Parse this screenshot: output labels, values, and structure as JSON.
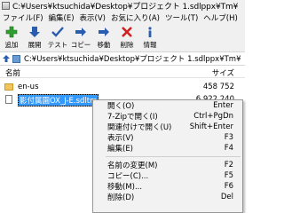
{
  "window": {
    "title": "C:¥Users¥ktsuchida¥Desktop¥プロジェクト 1.sdlppx¥Tm¥"
  },
  "menubar": [
    "ファイル(F)",
    "編集(E)",
    "表示(V)",
    "お気に入り(A)",
    "ツール(T)",
    "ヘルプ(H)"
  ],
  "toolbar": [
    {
      "label": "追加",
      "icon": "add-icon",
      "color": "#2e9e2e"
    },
    {
      "label": "展開",
      "icon": "extract-icon",
      "color": "#2a5db0"
    },
    {
      "label": "テスト",
      "icon": "test-icon",
      "color": "#2a5db0"
    },
    {
      "label": "コピー",
      "icon": "copy-icon",
      "color": "#2a5db0"
    },
    {
      "label": "移動",
      "icon": "move-icon",
      "color": "#2a5db0"
    },
    {
      "label": "削除",
      "icon": "delete-icon",
      "color": "#d02020"
    },
    {
      "label": "情報",
      "icon": "info-icon",
      "color": "#2a5db0"
    }
  ],
  "address": {
    "path": "C:¥Users¥ktsuchida¥Desktop¥プロジェクト 1.sdlppx¥Tm¥"
  },
  "list": {
    "col_name": "名前",
    "col_size": "サイズ",
    "rows": [
      {
        "name": "en-us",
        "size": "458 752",
        "kind": "folder"
      },
      {
        "name": "影付属園OX_J-E.sdltm",
        "size": "6 922 240",
        "kind": "file",
        "selected": true
      }
    ]
  },
  "context_menu": {
    "items": [
      {
        "label": "開く(O)",
        "shortcut": "Enter"
      },
      {
        "label": "7-Zipで開く(I)",
        "shortcut": "Ctrl+PgDn"
      },
      {
        "label": "関連付けで開く(U)",
        "shortcut": "Shift+Enter"
      },
      {
        "label": "表示(V)",
        "shortcut": "F3"
      },
      {
        "label": "編集(E)",
        "shortcut": "F4"
      },
      {
        "separator": true
      },
      {
        "label": "名前の変更(M)",
        "shortcut": "F2"
      },
      {
        "label": "コピー(C)...",
        "shortcut": "F5"
      },
      {
        "label": "移動(M)...",
        "shortcut": "F6"
      },
      {
        "label": "削除(D)",
        "shortcut": "Del"
      }
    ]
  }
}
